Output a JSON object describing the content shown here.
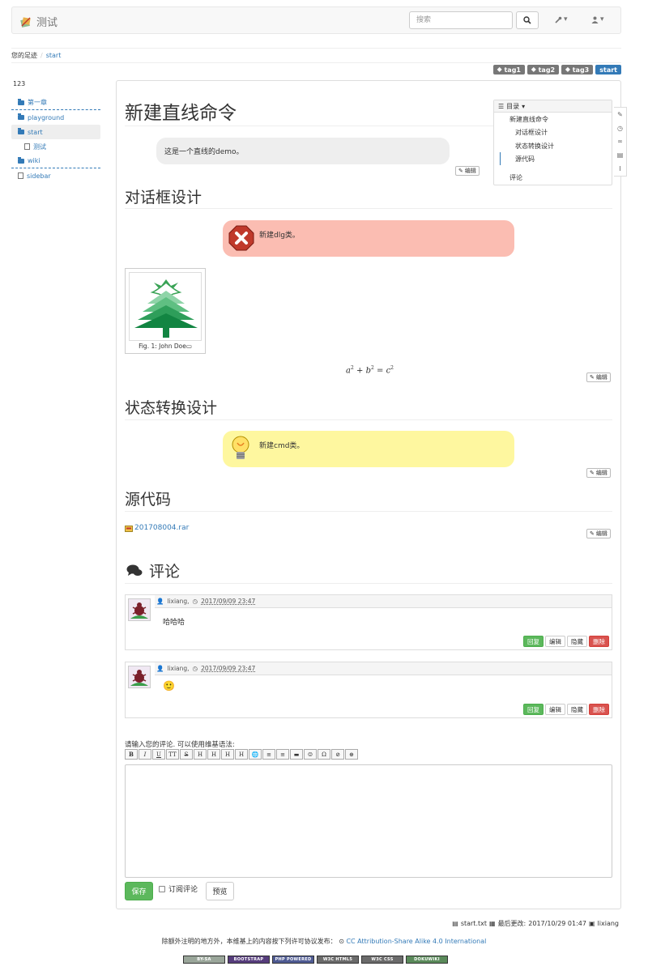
{
  "header": {
    "brand_title": "测试",
    "search_placeholder": "搜索",
    "tools_menu_icon": "wrench-icon",
    "user_menu_icon": "user-icon"
  },
  "breadcrumb": {
    "label": "您的足迹",
    "items": [
      "start"
    ]
  },
  "tags": [
    "tag1",
    "tag2",
    "tag3",
    "start"
  ],
  "sidebar": {
    "title": "123",
    "items": [
      {
        "label": "第一章",
        "icon": "folder-icon"
      },
      {
        "label": "playground",
        "icon": "folder-icon"
      },
      {
        "label": "start",
        "icon": "folder-open-icon"
      },
      {
        "label": "测试",
        "icon": "document-icon"
      },
      {
        "label": "wiki",
        "icon": "folder-icon"
      },
      {
        "label": "sidebar",
        "icon": "document-icon"
      }
    ]
  },
  "page": {
    "title": "新建直线命令",
    "intro_note": "这是一个直线的demo。",
    "edit_label": "编辑",
    "section1": {
      "title": "对话框设计",
      "note": "新建dlg类。",
      "figure_caption": "Fig. 1: John Doe",
      "math_a": "a",
      "math_b": "b",
      "math_c": "c",
      "math_exp": "2",
      "math_plus": "+",
      "math_eq": "="
    },
    "section2": {
      "title": "状态转换设计",
      "note": "新建cmd类。"
    },
    "section3": {
      "title": "源代码",
      "file": "201708004.rar"
    }
  },
  "toc": {
    "header": "目录",
    "items": [
      "新建直线命令",
      "对话框设计",
      "状态转换设计",
      "源代码",
      "评论"
    ]
  },
  "comments": {
    "title": "评论",
    "items": [
      {
        "author": "lixiang,",
        "date": "2017/09/09 23:47",
        "body": "哈哈哈"
      },
      {
        "author": "lixiang,",
        "date": "2017/09/09 23:47",
        "body": "🙂"
      }
    ],
    "actions": {
      "reply": "回复",
      "edit": "编辑",
      "hide": "隐藏",
      "delete": "删除"
    },
    "input_label": "请输入您的评论. 可以使用维基语法:",
    "toolbar": [
      "B",
      "I",
      "U",
      "TT",
      "S",
      "H",
      "H",
      "H",
      "H",
      "🌐",
      "≡",
      "≡",
      "▬",
      "☺",
      "Ω",
      "⊘",
      "⊕"
    ],
    "save": "保存",
    "subscribe": "订阅评论",
    "preview": "预览"
  },
  "footer": {
    "file": "start.txt",
    "last_modified_label": "最后更改:",
    "last_modified": "2017/10/29 01:47",
    "user": "lixiang",
    "license_text": "除额外注明的地方外，本维基上的内容按下列许可协议发布：",
    "license_link": "CC Attribution-Share Alike 4.0 International",
    "badges": [
      "BY-SA",
      "BOOTSTRAP",
      "PHP POWERED",
      "W3C HTML5",
      "W3C CSS",
      "DOKUWIKI"
    ]
  },
  "colors": {
    "link": "#337ab7",
    "error_note": "#fbbdb2",
    "tip_note": "#fef79f",
    "success": "#5cb85c",
    "danger": "#d9534f"
  }
}
